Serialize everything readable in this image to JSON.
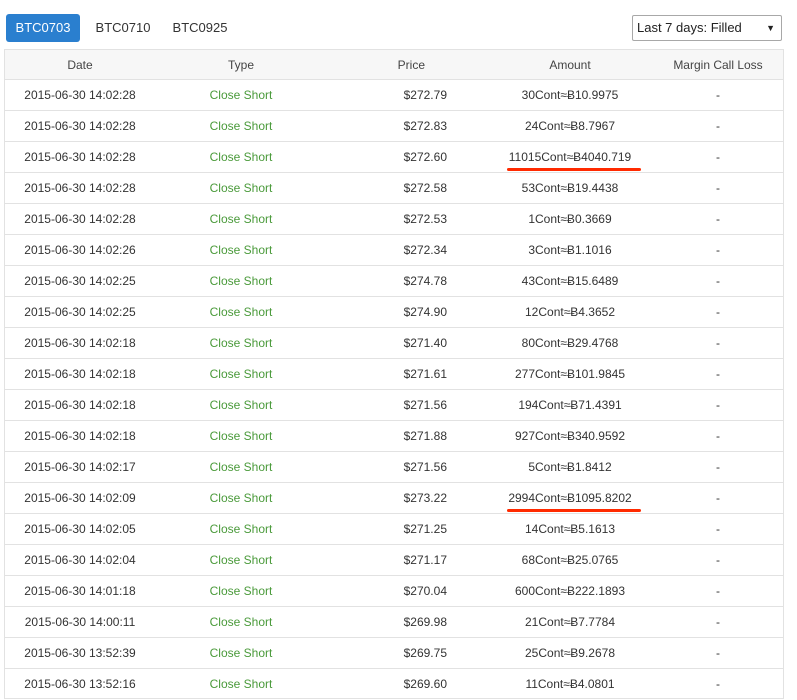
{
  "tabs": [
    {
      "label": "BTC0703",
      "active": true
    },
    {
      "label": "BTC0710",
      "active": false
    },
    {
      "label": "BTC0925",
      "active": false
    }
  ],
  "filter": {
    "selected": "Last 7 days: Filled"
  },
  "table": {
    "headers": [
      "Date",
      "Type",
      "Price",
      "Amount",
      "Margin Call Loss"
    ],
    "rows": [
      {
        "date": "2015-06-30 14:02:28",
        "type": "Close Short",
        "price": "$272.79",
        "amount": "30Cont≈Ƀ10.9975",
        "mcl": "-"
      },
      {
        "date": "2015-06-30 14:02:28",
        "type": "Close Short",
        "price": "$272.83",
        "amount": "24Cont≈Ƀ8.7967",
        "mcl": "-"
      },
      {
        "date": "2015-06-30 14:02:28",
        "type": "Close Short",
        "price": "$272.60",
        "amount": "11015Cont≈Ƀ4040.719",
        "mcl": "-"
      },
      {
        "date": "2015-06-30 14:02:28",
        "type": "Close Short",
        "price": "$272.58",
        "amount": "53Cont≈Ƀ19.4438",
        "mcl": "-"
      },
      {
        "date": "2015-06-30 14:02:28",
        "type": "Close Short",
        "price": "$272.53",
        "amount": "1Cont≈Ƀ0.3669",
        "mcl": "-"
      },
      {
        "date": "2015-06-30 14:02:26",
        "type": "Close Short",
        "price": "$272.34",
        "amount": "3Cont≈Ƀ1.1016",
        "mcl": "-"
      },
      {
        "date": "2015-06-30 14:02:25",
        "type": "Close Short",
        "price": "$274.78",
        "amount": "43Cont≈Ƀ15.6489",
        "mcl": "-"
      },
      {
        "date": "2015-06-30 14:02:25",
        "type": "Close Short",
        "price": "$274.90",
        "amount": "12Cont≈Ƀ4.3652",
        "mcl": "-"
      },
      {
        "date": "2015-06-30 14:02:18",
        "type": "Close Short",
        "price": "$271.40",
        "amount": "80Cont≈Ƀ29.4768",
        "mcl": "-"
      },
      {
        "date": "2015-06-30 14:02:18",
        "type": "Close Short",
        "price": "$271.61",
        "amount": "277Cont≈Ƀ101.9845",
        "mcl": "-"
      },
      {
        "date": "2015-06-30 14:02:18",
        "type": "Close Short",
        "price": "$271.56",
        "amount": "194Cont≈Ƀ71.4391",
        "mcl": "-"
      },
      {
        "date": "2015-06-30 14:02:18",
        "type": "Close Short",
        "price": "$271.88",
        "amount": "927Cont≈Ƀ340.9592",
        "mcl": "-"
      },
      {
        "date": "2015-06-30 14:02:17",
        "type": "Close Short",
        "price": "$271.56",
        "amount": "5Cont≈Ƀ1.8412",
        "mcl": "-"
      },
      {
        "date": "2015-06-30 14:02:09",
        "type": "Close Short",
        "price": "$273.22",
        "amount": "2994Cont≈Ƀ1095.8202",
        "mcl": "-"
      },
      {
        "date": "2015-06-30 14:02:05",
        "type": "Close Short",
        "price": "$271.25",
        "amount": "14Cont≈Ƀ5.1613",
        "mcl": "-"
      },
      {
        "date": "2015-06-30 14:02:04",
        "type": "Close Short",
        "price": "$271.17",
        "amount": "68Cont≈Ƀ25.0765",
        "mcl": "-"
      },
      {
        "date": "2015-06-30 14:01:18",
        "type": "Close Short",
        "price": "$270.04",
        "amount": "600Cont≈Ƀ222.1893",
        "mcl": "-"
      },
      {
        "date": "2015-06-30 14:00:11",
        "type": "Close Short",
        "price": "$269.98",
        "amount": "21Cont≈Ƀ7.7784",
        "mcl": "-"
      },
      {
        "date": "2015-06-30 13:52:39",
        "type": "Close Short",
        "price": "$269.75",
        "amount": "25Cont≈Ƀ9.2678",
        "mcl": "-"
      },
      {
        "date": "2015-06-30 13:52:16",
        "type": "Close Short",
        "price": "$269.60",
        "amount": "11Cont≈Ƀ4.0801",
        "mcl": "-"
      }
    ]
  },
  "annotations": {
    "color": "#ff2a00",
    "highlighted_rows": [
      2,
      13
    ]
  }
}
